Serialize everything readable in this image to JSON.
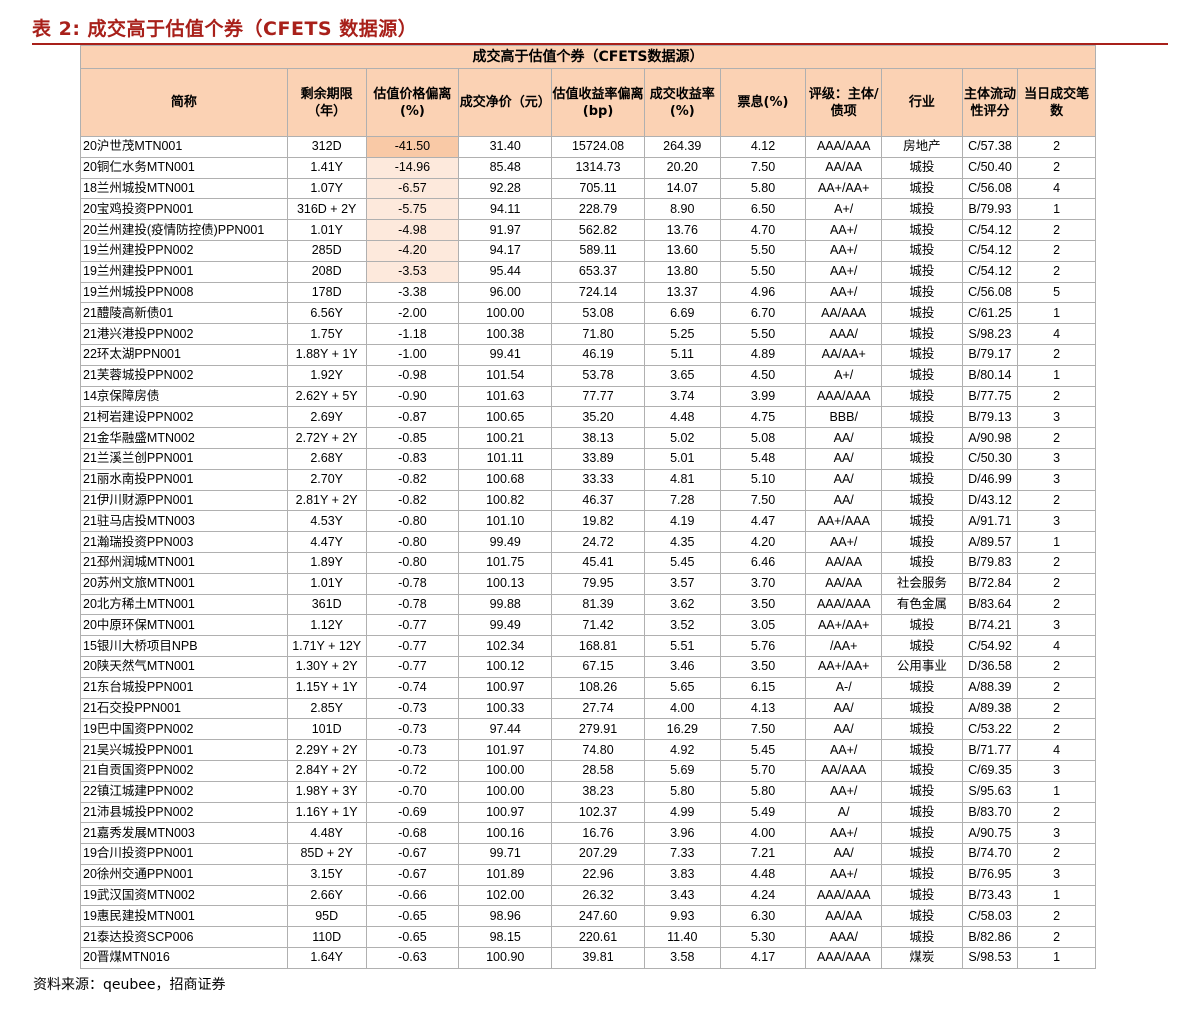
{
  "caption": "表 2:  成交高于估值个券（CFETS 数据源）",
  "table": {
    "title": "成交高于估值个券（CFETS数据源）",
    "headers": [
      "简称",
      "剩余期限（年）",
      "估值价格偏离(%)",
      "成交净价（元）",
      "估值收益率偏离(bp)",
      "成交收益率(%)",
      "票息(%)",
      "评级：主体/债项",
      "行业",
      "主体流动性评分",
      "当日成交笔数"
    ],
    "rows": [
      [
        "20沪世茂MTN001",
        "312D",
        "-41.50",
        "31.40",
        "15724.08",
        "264.39",
        "4.12",
        "AAA/AAA",
        "房地产",
        "C/57.38",
        "2"
      ],
      [
        "20铜仁水务MTN001",
        "1.41Y",
        "-14.96",
        "85.48",
        "1314.73",
        "20.20",
        "7.50",
        "AA/AA",
        "城投",
        "C/50.40",
        "2"
      ],
      [
        "18兰州城投MTN001",
        "1.07Y",
        "-6.57",
        "92.28",
        "705.11",
        "14.07",
        "5.80",
        "AA+/AA+",
        "城投",
        "C/56.08",
        "4"
      ],
      [
        "20宝鸡投资PPN001",
        "316D + 2Y",
        "-5.75",
        "94.11",
        "228.79",
        "8.90",
        "6.50",
        "A+/",
        "城投",
        "B/79.93",
        "1"
      ],
      [
        "20兰州建投(疫情防控债)PPN001",
        "1.01Y",
        "-4.98",
        "91.97",
        "562.82",
        "13.76",
        "4.70",
        "AA+/",
        "城投",
        "C/54.12",
        "2"
      ],
      [
        "19兰州建投PPN002",
        "285D",
        "-4.20",
        "94.17",
        "589.11",
        "13.60",
        "5.50",
        "AA+/",
        "城投",
        "C/54.12",
        "2"
      ],
      [
        "19兰州建投PPN001",
        "208D",
        "-3.53",
        "95.44",
        "653.37",
        "13.80",
        "5.50",
        "AA+/",
        "城投",
        "C/54.12",
        "2"
      ],
      [
        "19兰州城投PPN008",
        "178D",
        "-3.38",
        "96.00",
        "724.14",
        "13.37",
        "4.96",
        "AA+/",
        "城投",
        "C/56.08",
        "5"
      ],
      [
        "21醴陵高新债01",
        "6.56Y",
        "-2.00",
        "100.00",
        "53.08",
        "6.69",
        "6.70",
        "AA/AAA",
        "城投",
        "C/61.25",
        "1"
      ],
      [
        "21港兴港投PPN002",
        "1.75Y",
        "-1.18",
        "100.38",
        "71.80",
        "5.25",
        "5.50",
        "AAA/",
        "城投",
        "S/98.23",
        "4"
      ],
      [
        "22环太湖PPN001",
        "1.88Y + 1Y",
        "-1.00",
        "99.41",
        "46.19",
        "5.11",
        "4.89",
        "AA/AA+",
        "城投",
        "B/79.17",
        "2"
      ],
      [
        "21芙蓉城投PPN002",
        "1.92Y",
        "-0.98",
        "101.54",
        "53.78",
        "3.65",
        "4.50",
        "A+/",
        "城投",
        "B/80.14",
        "1"
      ],
      [
        "14京保障房债",
        "2.62Y + 5Y",
        "-0.90",
        "101.63",
        "77.77",
        "3.74",
        "3.99",
        "AAA/AAA",
        "城投",
        "B/77.75",
        "2"
      ],
      [
        "21柯岩建设PPN002",
        "2.69Y",
        "-0.87",
        "100.65",
        "35.20",
        "4.48",
        "4.75",
        "BBB/",
        "城投",
        "B/79.13",
        "3"
      ],
      [
        "21金华融盛MTN002",
        "2.72Y + 2Y",
        "-0.85",
        "100.21",
        "38.13",
        "5.02",
        "5.08",
        "AA/",
        "城投",
        "A/90.98",
        "2"
      ],
      [
        "21兰溪兰创PPN001",
        "2.68Y",
        "-0.83",
        "101.11",
        "33.89",
        "5.01",
        "5.48",
        "AA/",
        "城投",
        "C/50.30",
        "3"
      ],
      [
        "21丽水南投PPN001",
        "2.70Y",
        "-0.82",
        "100.68",
        "33.33",
        "4.81",
        "5.10",
        "AA/",
        "城投",
        "D/46.99",
        "3"
      ],
      [
        "21伊川财源PPN001",
        "2.81Y + 2Y",
        "-0.82",
        "100.82",
        "46.37",
        "7.28",
        "7.50",
        "AA/",
        "城投",
        "D/43.12",
        "2"
      ],
      [
        "21驻马店投MTN003",
        "4.53Y",
        "-0.80",
        "101.10",
        "19.82",
        "4.19",
        "4.47",
        "AA+/AAA",
        "城投",
        "A/91.71",
        "3"
      ],
      [
        "21瀚瑞投资PPN003",
        "4.47Y",
        "-0.80",
        "99.49",
        "24.72",
        "4.35",
        "4.20",
        "AA+/",
        "城投",
        "A/89.57",
        "1"
      ],
      [
        "21邳州润城MTN001",
        "1.89Y",
        "-0.80",
        "101.75",
        "45.41",
        "5.45",
        "6.46",
        "AA/AA",
        "城投",
        "B/79.83",
        "2"
      ],
      [
        "20苏州文旅MTN001",
        "1.01Y",
        "-0.78",
        "100.13",
        "79.95",
        "3.57",
        "3.70",
        "AA/AA",
        "社会服务",
        "B/72.84",
        "2"
      ],
      [
        "20北方稀土MTN001",
        "361D",
        "-0.78",
        "99.88",
        "81.39",
        "3.62",
        "3.50",
        "AAA/AAA",
        "有色金属",
        "B/83.64",
        "2"
      ],
      [
        "20中原环保MTN001",
        "1.12Y",
        "-0.77",
        "99.49",
        "71.42",
        "3.52",
        "3.05",
        "AA+/AA+",
        "城投",
        "B/74.21",
        "3"
      ],
      [
        "15银川大桥项目NPB",
        "1.71Y + 12Y",
        "-0.77",
        "102.34",
        "168.81",
        "5.51",
        "5.76",
        "/AA+",
        "城投",
        "C/54.92",
        "4"
      ],
      [
        "20陕天然气MTN001",
        "1.30Y + 2Y",
        "-0.77",
        "100.12",
        "67.15",
        "3.46",
        "3.50",
        "AA+/AA+",
        "公用事业",
        "D/36.58",
        "2"
      ],
      [
        "21东台城投PPN001",
        "1.15Y + 1Y",
        "-0.74",
        "100.97",
        "108.26",
        "5.65",
        "6.15",
        "A-/",
        "城投",
        "A/88.39",
        "2"
      ],
      [
        "21石交投PPN001",
        "2.85Y",
        "-0.73",
        "100.33",
        "27.74",
        "4.00",
        "4.13",
        "AA/",
        "城投",
        "A/89.38",
        "2"
      ],
      [
        "19巴中国资PPN002",
        "101D",
        "-0.73",
        "97.44",
        "279.91",
        "16.29",
        "7.50",
        "AA/",
        "城投",
        "C/53.22",
        "2"
      ],
      [
        "21吴兴城投PPN001",
        "2.29Y + 2Y",
        "-0.73",
        "101.97",
        "74.80",
        "4.92",
        "5.45",
        "AA+/",
        "城投",
        "B/71.77",
        "4"
      ],
      [
        "21自贡国资PPN002",
        "2.84Y + 2Y",
        "-0.72",
        "100.00",
        "28.58",
        "5.69",
        "5.70",
        "AA/AAA",
        "城投",
        "C/69.35",
        "3"
      ],
      [
        "22镇江城建PPN002",
        "1.98Y + 3Y",
        "-0.70",
        "100.00",
        "38.23",
        "5.80",
        "5.80",
        "AA+/",
        "城投",
        "S/95.63",
        "1"
      ],
      [
        "21沛县城投PPN002",
        "1.16Y + 1Y",
        "-0.69",
        "100.97",
        "102.37",
        "4.99",
        "5.49",
        "A/",
        "城投",
        "B/83.70",
        "2"
      ],
      [
        "21嘉秀发展MTN003",
        "4.48Y",
        "-0.68",
        "100.16",
        "16.76",
        "3.96",
        "4.00",
        "AA+/",
        "城投",
        "A/90.75",
        "3"
      ],
      [
        "19合川投资PPN001",
        "85D + 2Y",
        "-0.67",
        "99.71",
        "207.29",
        "7.33",
        "7.21",
        "AA/",
        "城投",
        "B/74.70",
        "2"
      ],
      [
        "20徐州交通PPN001",
        "3.15Y",
        "-0.67",
        "101.89",
        "22.96",
        "3.83",
        "4.48",
        "AA+/",
        "城投",
        "B/76.95",
        "3"
      ],
      [
        "19武汉国资MTN002",
        "2.66Y",
        "-0.66",
        "102.00",
        "26.32",
        "3.43",
        "4.24",
        "AAA/AAA",
        "城投",
        "B/73.43",
        "1"
      ],
      [
        "19惠民建投MTN001",
        "95D",
        "-0.65",
        "98.96",
        "247.60",
        "9.93",
        "6.30",
        "AA/AA",
        "城投",
        "C/58.03",
        "2"
      ],
      [
        "21泰达投资SCP006",
        "110D",
        "-0.65",
        "98.15",
        "220.61",
        "11.40",
        "5.30",
        "AAA/",
        "城投",
        "B/82.86",
        "2"
      ],
      [
        "20晋煤MTN016",
        "1.64Y",
        "-0.63",
        "100.90",
        "39.81",
        "3.58",
        "4.17",
        "AAA/AAA",
        "煤炭",
        "S/98.53",
        "1"
      ]
    ]
  },
  "source": "资料来源：qeubee，招商证券",
  "colors": {
    "accent": "#a8201a",
    "header_bg": "#fbd2b4",
    "highlight": "#f9c9a6",
    "highlight_light": "#fde9dc"
  }
}
